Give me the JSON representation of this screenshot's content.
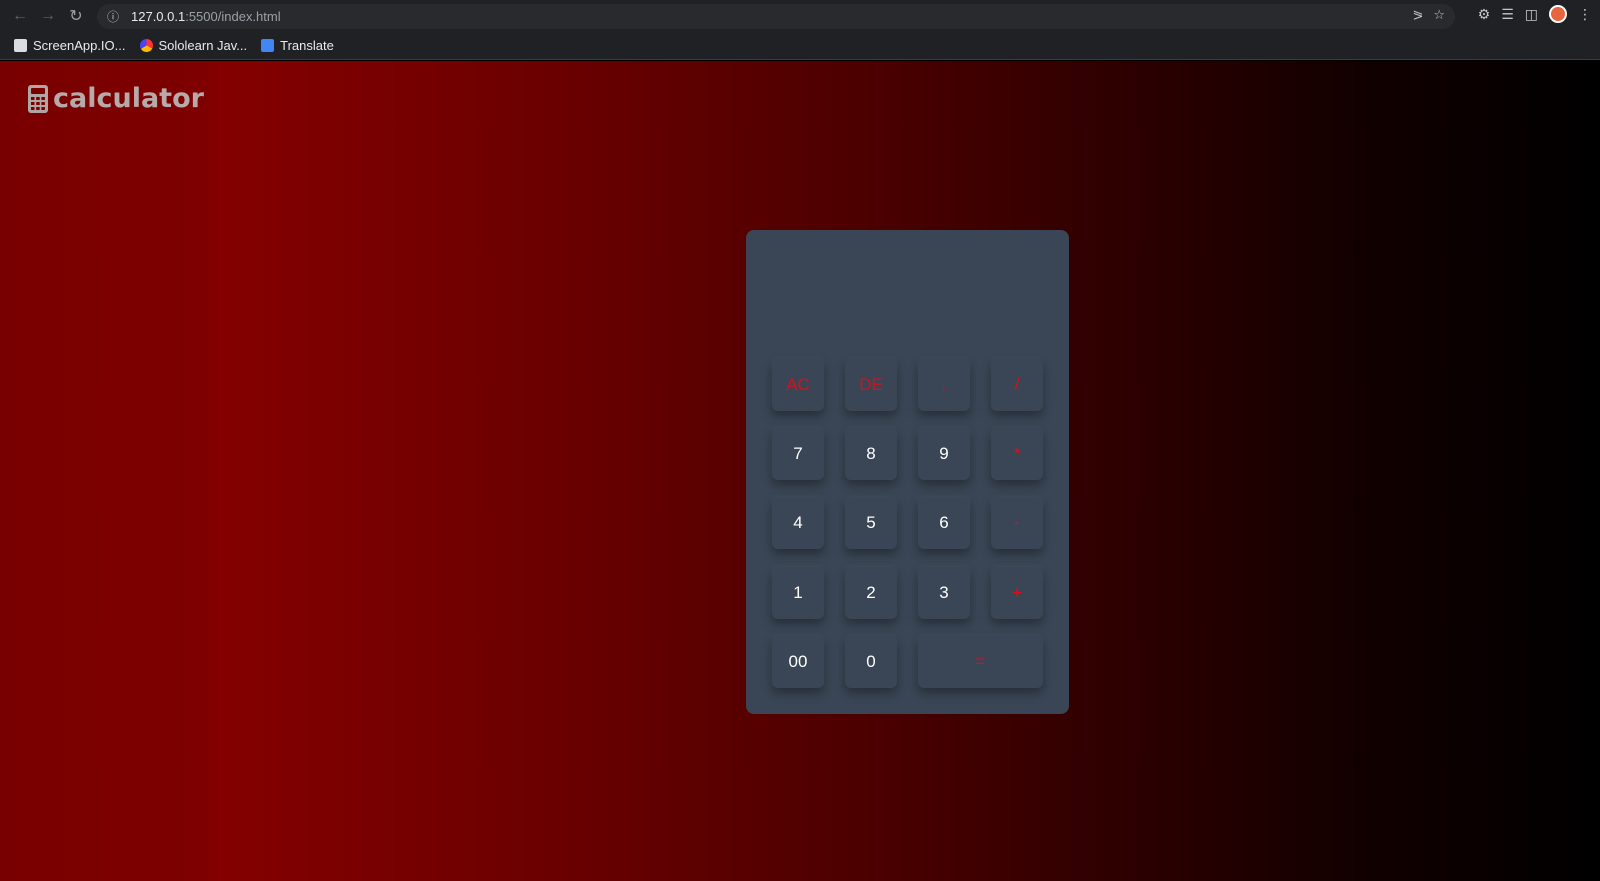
{
  "browser": {
    "url_host": "127.0.0.1",
    "url_path": ":5500/index.html",
    "bookmarks": [
      {
        "label": "ScreenApp.IO...",
        "icon": "screen-icon"
      },
      {
        "label": "Sololearn Jav...",
        "icon": "sololearn-icon"
      },
      {
        "label": "Translate",
        "icon": "translate-icon"
      }
    ]
  },
  "app": {
    "logo_text": "calculator",
    "display_value": ""
  },
  "keys": {
    "ac": "AC",
    "de": "DE",
    "dot": ".",
    "div": "/",
    "k7": "7",
    "k8": "8",
    "k9": "9",
    "mul": "*",
    "k4": "4",
    "k5": "5",
    "k6": "6",
    "sub": "-",
    "k1": "1",
    "k2": "2",
    "k3": "3",
    "add": "+",
    "k00": "00",
    "k0": "0",
    "eq": "="
  },
  "colors": {
    "operator": "#e20b18",
    "panel": "#3a4655",
    "digit": "#ffffff",
    "gradient_start": "#850000",
    "gradient_end": "#000000"
  }
}
